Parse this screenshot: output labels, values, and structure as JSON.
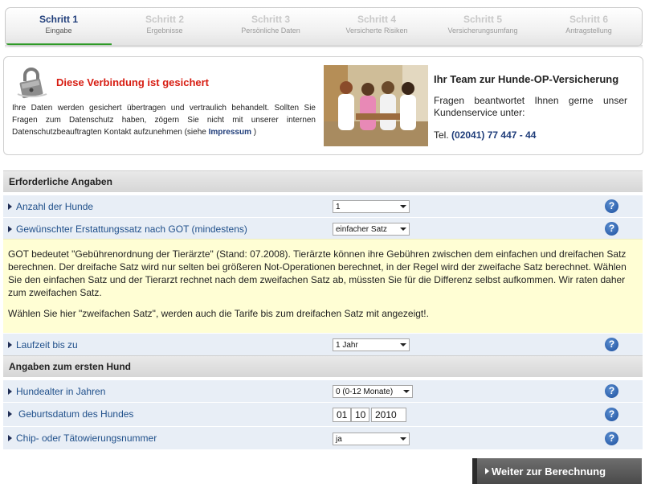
{
  "steps": [
    {
      "number": "Schritt 1",
      "label": "Eingabe"
    },
    {
      "number": "Schritt 2",
      "label": "Ergebnisse"
    },
    {
      "number": "Schritt 3",
      "label": "Persönliche Daten"
    },
    {
      "number": "Schritt 4",
      "label": "Versicherte Risiken"
    },
    {
      "number": "Schritt 5",
      "label": "Versicherungsumfang"
    },
    {
      "number": "Schritt 6",
      "label": "Antragstellung"
    }
  ],
  "security": {
    "title": "Diese Verbindung ist gesichert",
    "text": "Ihre Daten werden gesichert übertragen und vertraulich behandelt. Sollten Sie Fragen zum Datenschutz haben, zögern Sie nicht mit unserer internen Datenschutzbeauftragten Kontakt aufzunehmen (siehe",
    "link": "Impressum",
    "text_end": ")"
  },
  "team": {
    "title": "Ihr Team zur Hunde-OP-Versicherung",
    "text": "Fragen beantwortet Ihnen gerne unser Kundenservice unter:",
    "phone_prefix": "Tel.",
    "phone": "(02041) 77 447 - 44"
  },
  "sections": {
    "required": "Erforderliche Angaben",
    "first_dog": "Angaben zum ersten Hund"
  },
  "fields": {
    "dogs_count": {
      "label": "Anzahl der Hunde",
      "value": "1"
    },
    "reimbursement": {
      "label": "Gewünschter Erstattungssatz nach GOT (mindestens)",
      "value": "einfacher Satz"
    },
    "duration": {
      "label": "Laufzeit bis zu",
      "value": "1 Jahr"
    },
    "dog_age": {
      "label": "Hundealter in Jahren",
      "value": "0 (0-12 Monate)"
    },
    "birthdate": {
      "label": "Geburtsdatum des Hundes",
      "day": "01",
      "month": "10",
      "year": "2010"
    },
    "chip": {
      "label": "Chip- oder Tätowierungsnummer",
      "value": "ja"
    }
  },
  "note": {
    "p1": "GOT bedeutet \"Gebührenordnung der Tierärzte\" (Stand: 07.2008). Tierärzte können ihre Gebühren zwischen dem einfachen und dreifachen Satz berechnen. Der dreifache Satz wird nur selten bei größeren Not-Operationen berechnet, in der Regel wird der zweifache Satz berechnet. Wählen Sie den einfachen Satz und der Tierarzt rechnet nach dem zweifachen Satz ab, müssten Sie für die Differenz selbst aufkommen. Wir raten daher zum zweifachen Satz.",
    "p2": "Wählen Sie hier \"zweifachen Satz\", werden auch die Tarife bis zum dreifachen Satz mit angezeigt!."
  },
  "help_symbol": "?",
  "buttons": {
    "next": "Weiter zur Berechnung"
  },
  "colors": {
    "accent": "#1f3d7a",
    "secure_red": "#d71d12",
    "active_step_bar": "#2f9b27",
    "row_bg": "#e8eef6",
    "note_bg": "#fffed4"
  }
}
